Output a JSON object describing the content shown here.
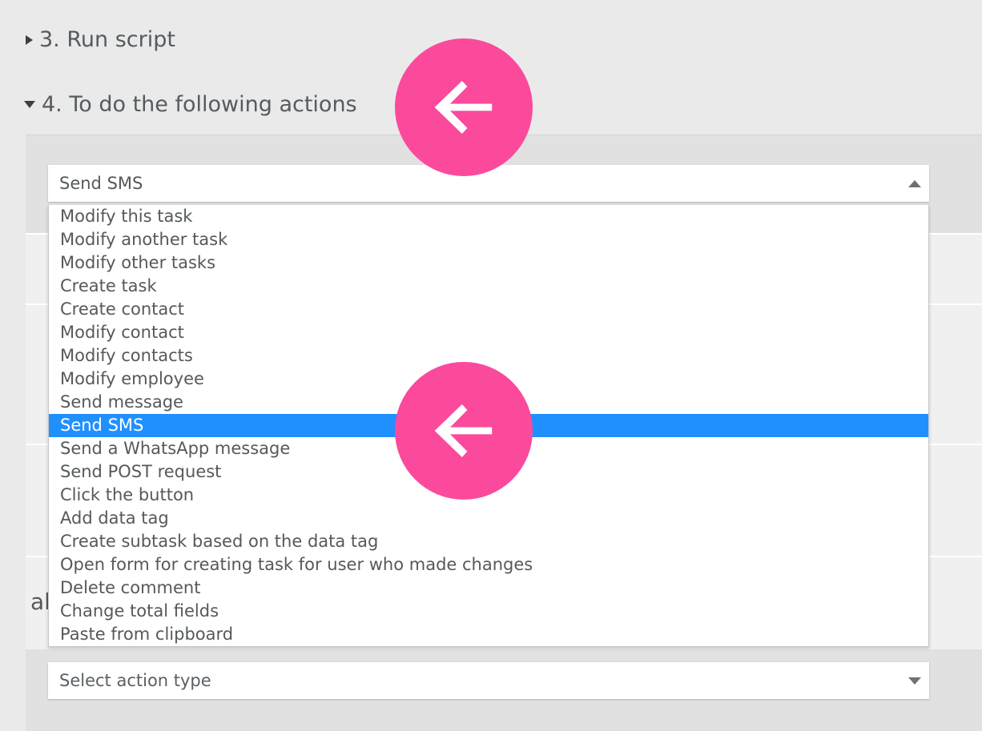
{
  "sections": [
    {
      "number_label": "3. Run script",
      "expanded": false,
      "marker_icon": "triangle-right-icon"
    },
    {
      "number_label": "4. To do the following actions",
      "expanded": true,
      "marker_icon": "triangle-down-icon"
    }
  ],
  "panel": {
    "obscured_label": "al",
    "background_color": "#e1e1e1",
    "row_color": "#f0f0f0"
  },
  "action_select": {
    "selected_value": "Send SMS",
    "state": "open",
    "arrow_icon": "chevron-up-icon",
    "options": [
      "Modify this task",
      "Modify another task",
      "Modify other tasks",
      "Create task",
      "Create contact",
      "Modify contact",
      "Modify contacts",
      "Modify employee",
      "Send message",
      "Send SMS",
      "Send a WhatsApp message",
      "Send POST request",
      "Click the button",
      "Add data tag",
      "Create subtask based on the data tag",
      "Open form for creating task for user who made changes",
      "Delete comment",
      "Change total fields",
      "Paste from clipboard"
    ],
    "highlighted_option": "Send SMS",
    "highlight_color": "#2190ff"
  },
  "new_action_select": {
    "placeholder": "Select action type",
    "state": "closed",
    "arrow_icon": "chevron-down-icon"
  },
  "annotations": {
    "color": "#fb4a9c",
    "arrows": [
      {
        "icon": "arrow-left-icon",
        "target": "action-section-header"
      },
      {
        "icon": "arrow-left-icon",
        "target": "send-sms-option"
      }
    ]
  },
  "colors": {
    "page_background": "#eaeaea",
    "text": "#55595c",
    "accent_pink": "#fb4a9c",
    "accent_blue": "#2190ff"
  }
}
